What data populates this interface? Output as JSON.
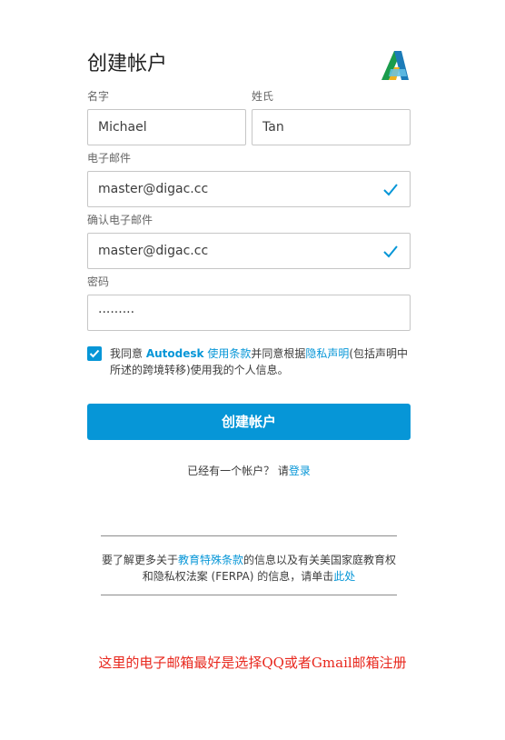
{
  "form": {
    "title": "创建帐户",
    "first_name_label": "名字",
    "first_name_value": "Michael",
    "last_name_label": "姓氏",
    "last_name_value": "Tan",
    "email_label": "电子邮件",
    "email_value": "master@digac.cc",
    "confirm_email_label": "确认电子邮件",
    "confirm_email_value": "master@digac.cc",
    "password_label": "密码",
    "password_value": "·········",
    "consent_checked": true,
    "consent_part1": "我同意 ",
    "consent_brand": "Autodesk",
    "consent_terms_link": " 使用条款",
    "consent_part2": "并同意根据",
    "consent_privacy_link": "隐私声明",
    "consent_part3": "(包括声明中所述的跨境转移)使用我的个人信息。",
    "submit_label": "创建帐户",
    "signin_prefix": "已经有一个帐户？ 请",
    "signin_link": "登录"
  },
  "education": {
    "part1": "要了解更多关于",
    "terms_link": "教育特殊条款",
    "part2": "的信息以及有关美国家庭教育权和隐私权法案 (FERPA) 的信息，请单击",
    "here_link": "此处"
  },
  "annotation": {
    "note": "这里的电子邮箱最好是选择QQ或者Gmail邮箱注册"
  },
  "colors": {
    "accent": "#0696d7",
    "annotation": "#e8281e"
  },
  "icons": [
    "autodesk-logo",
    "check-icon",
    "checkbox-checked-icon"
  ]
}
